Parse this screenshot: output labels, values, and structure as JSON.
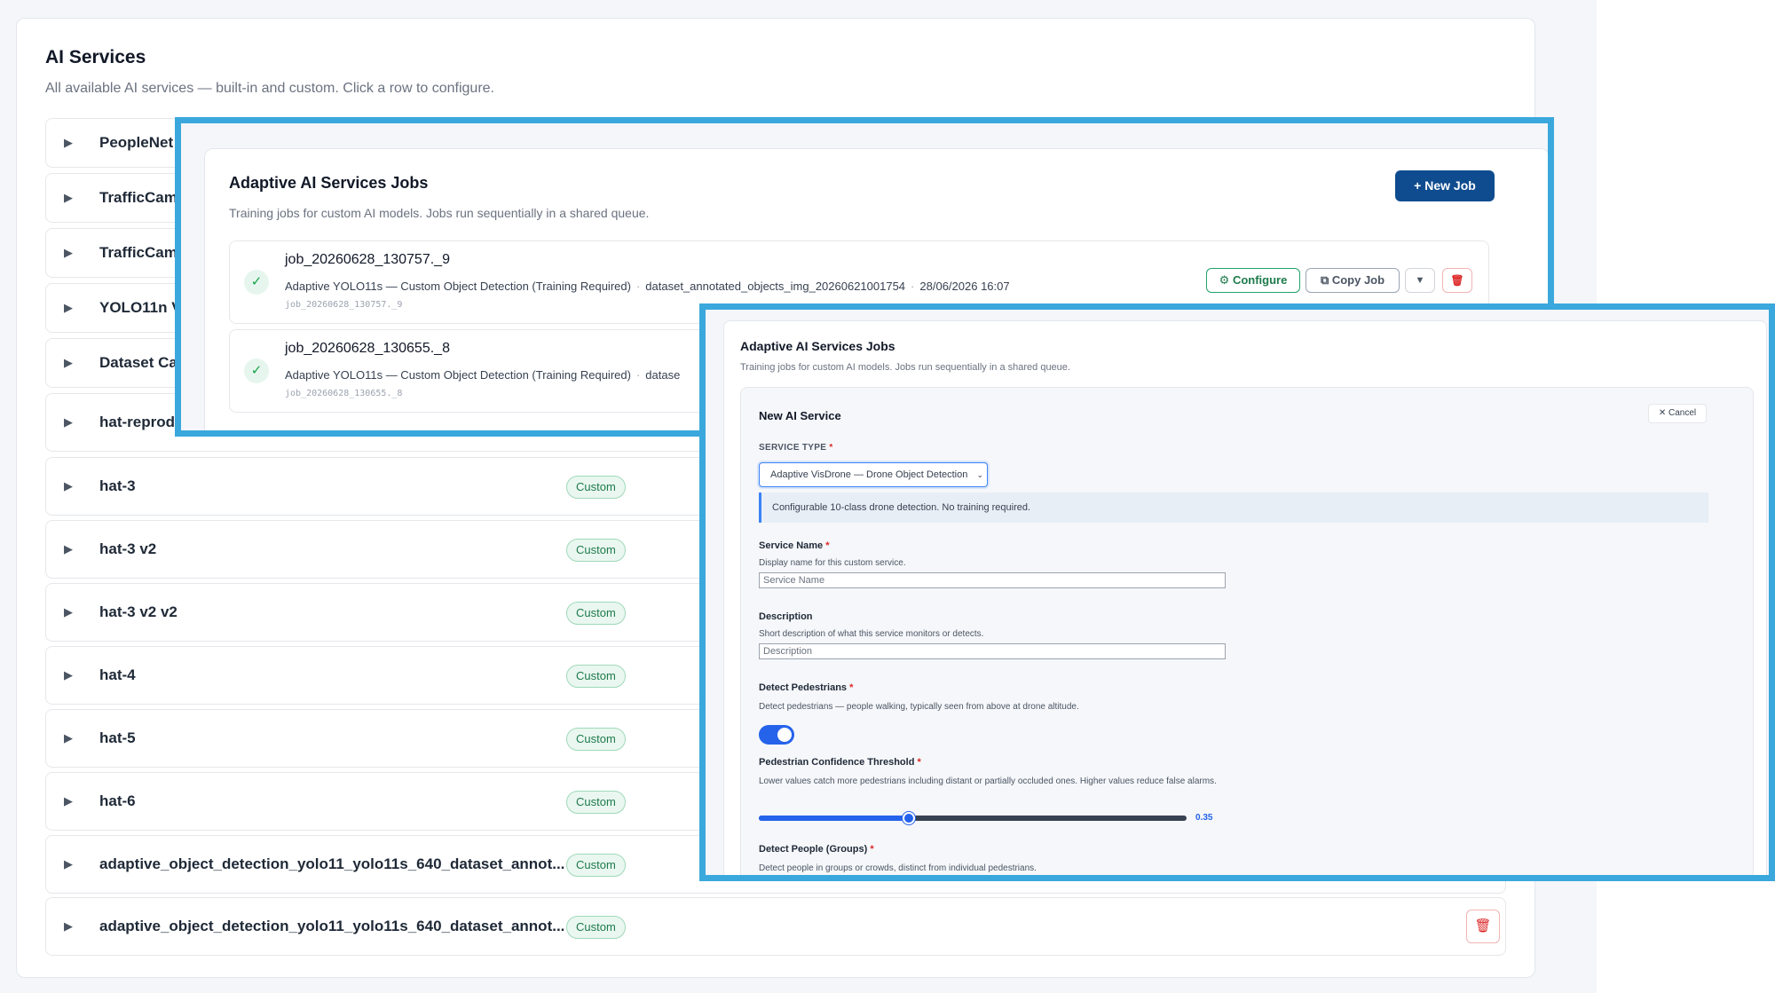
{
  "main": {
    "title": "AI Services",
    "subtitle": "All available AI services — built-in and custom. Click a row to configure.",
    "services": [
      {
        "name": "PeopleNet",
        "badge": ""
      },
      {
        "name": "TrafficCam",
        "badge": ""
      },
      {
        "name": "TrafficCam",
        "badge": ""
      },
      {
        "name": "YOLO11n V",
        "badge": ""
      },
      {
        "name": "Dataset Ca",
        "badge": ""
      },
      {
        "name": "hat-reprod",
        "badge": ""
      },
      {
        "name": "hat-3",
        "badge": "Custom"
      },
      {
        "name": "hat-3 v2",
        "badge": "Custom"
      },
      {
        "name": "hat-3 v2 v2",
        "badge": "Custom"
      },
      {
        "name": "hat-4",
        "badge": "Custom"
      },
      {
        "name": "hat-5",
        "badge": "Custom"
      },
      {
        "name": "hat-6",
        "badge": "Custom"
      },
      {
        "name": "adaptive_object_detection_yolo11_yolo11s_640_dataset_annot...",
        "badge": "Custom"
      },
      {
        "name": "adaptive_object_detection_yolo11_yolo11s_640_dataset_annot...",
        "badge": "Custom"
      }
    ]
  },
  "jobs_panel": {
    "title": "Adaptive AI Services Jobs",
    "subtitle": "Training jobs for custom AI models. Jobs run sequentially in a shared queue.",
    "new_job_label": "+ New Job",
    "jobs": [
      {
        "name": "job_20260628_130757._9",
        "model": "Adaptive YOLO11s — Custom Object Detection (Training Required)",
        "dataset": "dataset_annotated_objects_img_20260621001754",
        "date": "28/06/2026 16:07",
        "id": "job_20260628_130757._9",
        "status_icon": "check-icon"
      },
      {
        "name": "job_20260628_130655._8",
        "model": "Adaptive YOLO11s — Custom Object Detection (Training Required)",
        "dataset": "datase",
        "date": "",
        "id": "job_20260628_130655._8",
        "status_icon": "check-icon"
      }
    ],
    "buttons": {
      "configure": "⚙ Configure",
      "copy": "⧉ Copy Job",
      "caret": "▼",
      "delete": "🗑"
    }
  },
  "new_service_panel": {
    "title": "Adaptive AI Services Jobs",
    "subtitle": "Training jobs for custom AI models. Jobs run sequentially in a shared queue.",
    "form_title": "New AI Service",
    "cancel_label": "✕ Cancel",
    "service_type": {
      "label": "SERVICE TYPE",
      "value": "Adaptive VisDrone — Drone Object Detection",
      "info": "Configurable 10-class drone detection. No training required."
    },
    "service_name": {
      "label": "Service Name",
      "help": "Display name for this custom service.",
      "placeholder": "Service Name"
    },
    "description": {
      "label": "Description",
      "help": "Short description of what this service monitors or detects.",
      "placeholder": "Description"
    },
    "detect_pedestrians": {
      "label": "Detect Pedestrians",
      "help": "Detect pedestrians — people walking, typically seen from above at drone altitude.",
      "enabled": true
    },
    "pedestrian_threshold": {
      "label": "Pedestrian Confidence Threshold",
      "help": "Lower values catch more pedestrians including distant or partially occluded ones. Higher values reduce false alarms.",
      "value": 0.35,
      "value_text": "0.35"
    },
    "detect_people_groups": {
      "label": "Detect People (Groups)",
      "help": "Detect people in groups or crowds, distinct from individual pedestrians."
    },
    "required_mark": "*"
  },
  "colors": {
    "accent": "#3aa8dc",
    "primary_button": "#0f4c8f",
    "custom_badge": "#1e7a4c",
    "toggle_on": "#2563eb"
  }
}
